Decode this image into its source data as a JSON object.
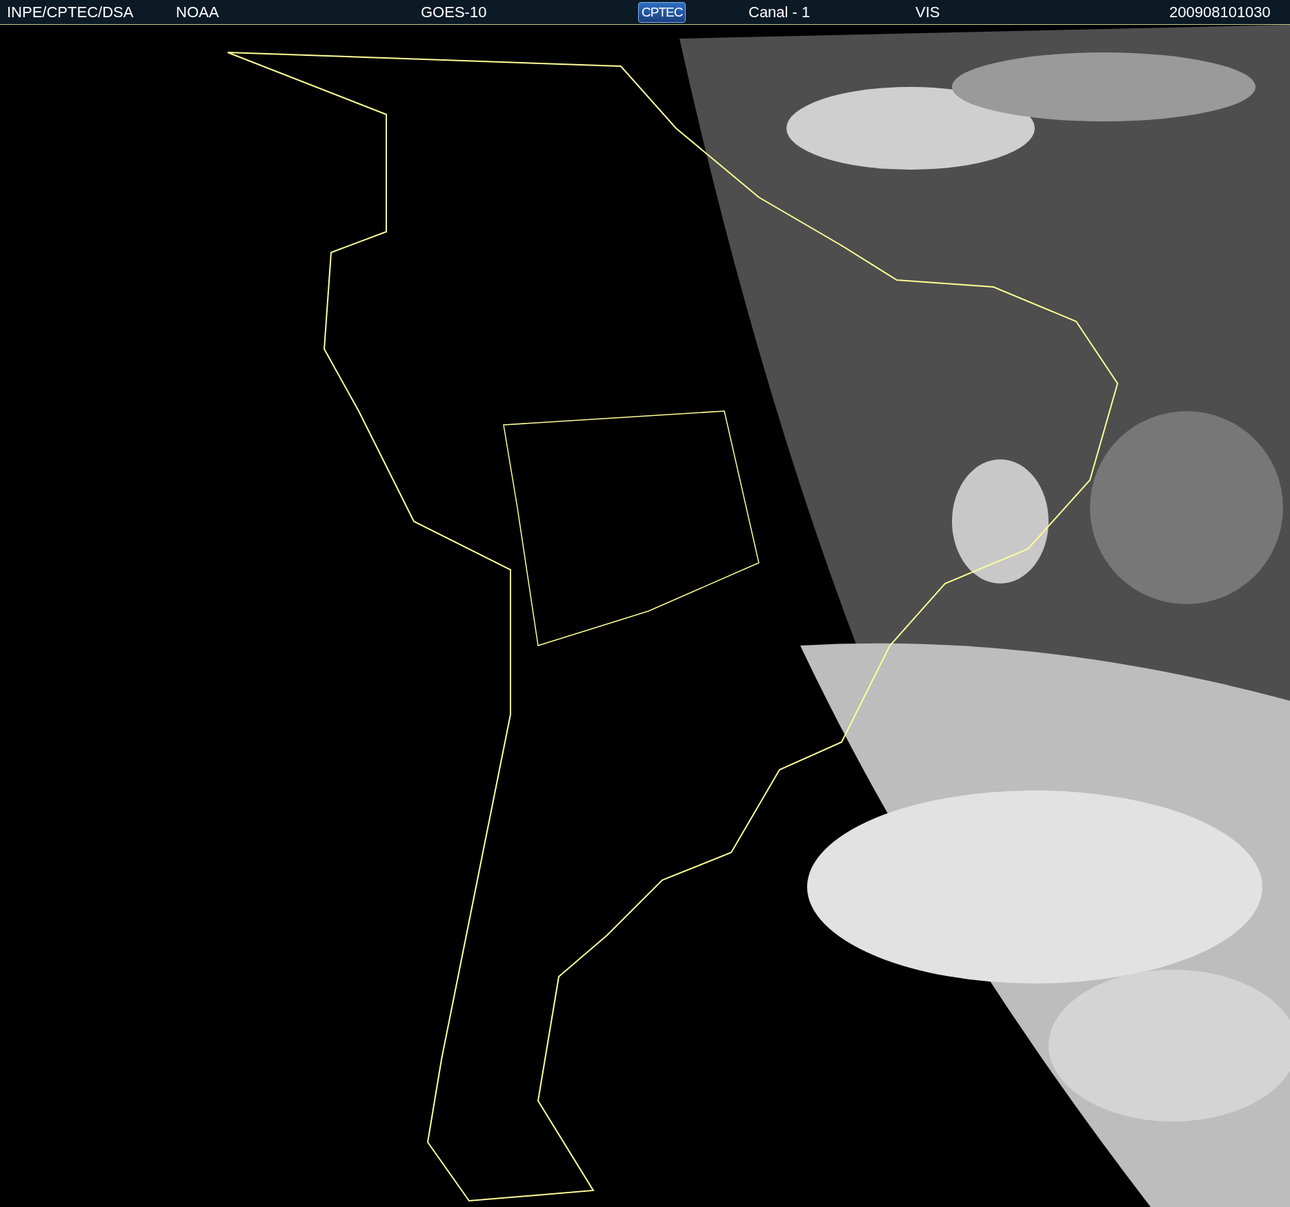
{
  "header": {
    "items": [
      {
        "kind": "text",
        "text": "INPE/CPTEC/DSA"
      },
      {
        "kind": "text",
        "text": "NOAA"
      },
      {
        "kind": "text",
        "text": "GOES-10"
      },
      {
        "kind": "logo",
        "text": "CPTEC"
      },
      {
        "kind": "text",
        "text": "Canal - 1"
      },
      {
        "kind": "text",
        "text": "VIS"
      },
      {
        "kind": "text",
        "text": "200908101030"
      }
    ]
  }
}
